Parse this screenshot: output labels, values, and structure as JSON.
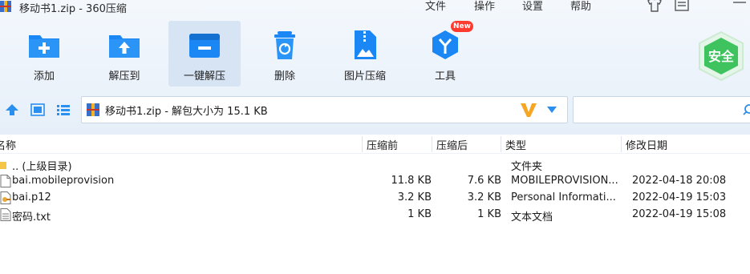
{
  "window": {
    "title": "移动书1.zip - 360压缩",
    "menus": [
      "文件",
      "操作",
      "设置",
      "帮助"
    ]
  },
  "toolbar": {
    "buttons": [
      {
        "label": "添加",
        "icon": "add-folder-icon"
      },
      {
        "label": "解压到",
        "icon": "extract-to-folder-icon"
      },
      {
        "label": "一键解压",
        "icon": "one-click-extract-icon"
      },
      {
        "label": "删除",
        "icon": "trash-icon"
      },
      {
        "label": "图片压缩",
        "icon": "image-compress-icon"
      },
      {
        "label": "工具",
        "icon": "tools-icon"
      }
    ],
    "new_badge": "New",
    "safe_badge": "安全",
    "accent": "#2b8ff0"
  },
  "address": {
    "path": "移动书1.zip - 解包大小为 15.1 KB",
    "search_placeholder": ""
  },
  "table": {
    "columns": [
      "名称",
      "压缩前",
      "压缩后",
      "类型",
      "修改日期"
    ],
    "rows": [
      {
        "name": ".. (上级目录)",
        "before": "",
        "after": "",
        "type": "文件夹",
        "date": "",
        "icon": "folder-icon"
      },
      {
        "name": "bai.mobileprovision",
        "before": "11.8 KB",
        "after": "7.6 KB",
        "type": "MOBILEPROVISION...",
        "date": "2022-04-18 20:08",
        "icon": "file-icon"
      },
      {
        "name": "bai.p12",
        "before": "3.2 KB",
        "after": "3.2 KB",
        "type": "Personal Informati...",
        "date": "2022-04-19 15:03",
        "icon": "certificate-file-icon"
      },
      {
        "name": "密码.txt",
        "before": "1 KB",
        "after": "1 KB",
        "type": "文本文档",
        "date": "2022-04-19 15:08",
        "icon": "text-file-icon"
      }
    ]
  }
}
